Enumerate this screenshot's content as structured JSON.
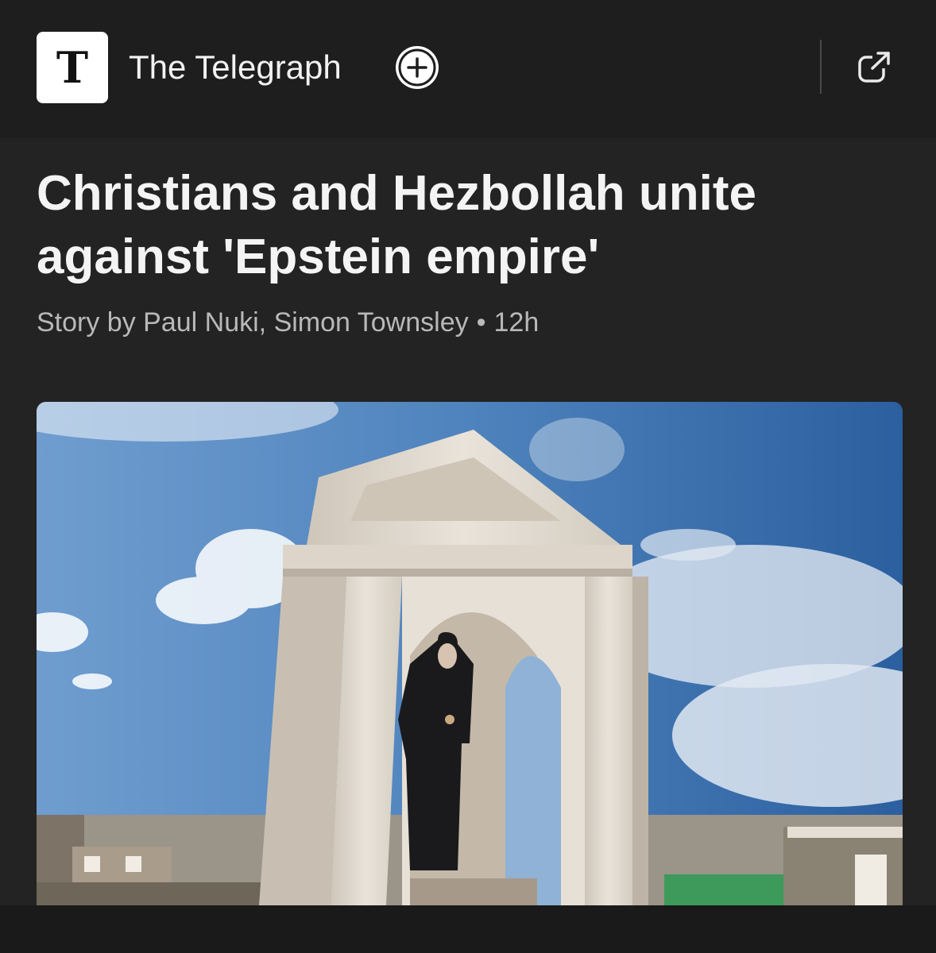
{
  "publisher": {
    "logo_letter": "T",
    "name": "The Telegraph",
    "follow_icon": "plus-icon",
    "open_icon": "external-link-icon"
  },
  "article": {
    "headline": "Christians and Hezbollah unite against 'Epstein empire'",
    "byline": "Story by Paul Nuki, Simon Townsley",
    "separator": "•",
    "age": "12h"
  },
  "hero_image": {
    "subject": "white stone shrine with a statue of a robed saint under a blue cloudy sky"
  }
}
